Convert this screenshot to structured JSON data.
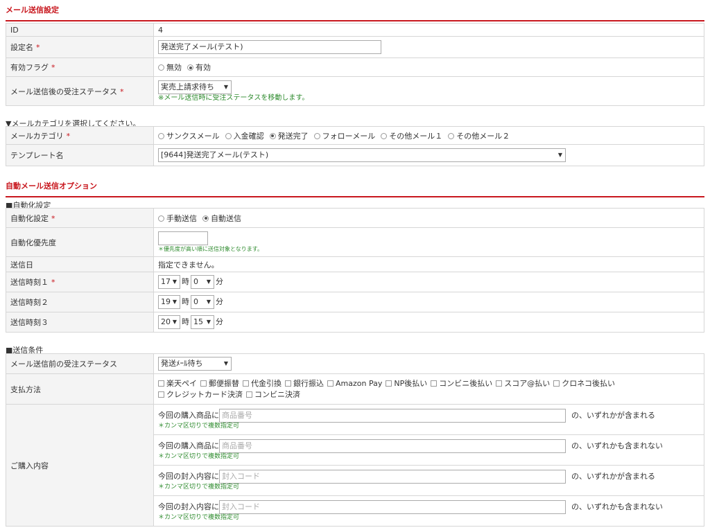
{
  "mail_section": {
    "title": "メール送信設定",
    "id_label": "ID",
    "id_value": "4",
    "name_label": "設定名",
    "name_value": "発送完了メール(テスト)",
    "flag_label": "有効フラグ",
    "flag_options": [
      "無効",
      "有効"
    ],
    "flag_selected": "有効",
    "after_status_label": "メール送信後の受注ステータス",
    "after_status_value": "実売上請求待ち",
    "after_status_note": "※メール送信時に受注ステータスを移動します。",
    "required_mark": "*"
  },
  "category_section": {
    "title": "▼メールカテゴリを選択してください。",
    "category_label": "メールカテゴリ",
    "categories": [
      "サンクスメール",
      "入金確認",
      "発送完了",
      "フォローメール",
      "その他メール１",
      "その他メール２"
    ],
    "category_selected": "発送完了",
    "template_label": "テンプレート名",
    "template_value": "[9644]発送完了メール(テスト)"
  },
  "auto_section": {
    "title": "自動メール送信オプション",
    "sub_title": "■自動化設定",
    "auto_label": "自動化設定",
    "auto_options": [
      "手動送信",
      "自動送信"
    ],
    "auto_selected": "自動送信",
    "priority_label": "自動化優先度",
    "priority_value": "",
    "priority_note": "＊優先度が高い順に送信対象となります。",
    "send_date_label": "送信日",
    "send_date_value": "指定できません。",
    "time_unit_hour": "時",
    "time_unit_min": "分",
    "times": [
      {
        "label": "送信時刻１",
        "hour": "17",
        "min": "0",
        "required": true
      },
      {
        "label": "送信時刻２",
        "hour": "19",
        "min": "0",
        "required": false
      },
      {
        "label": "送信時刻３",
        "hour": "20",
        "min": "15",
        "required": false
      }
    ]
  },
  "condition_section": {
    "sub_title": "■送信条件",
    "before_status_label": "メール送信前の受注ステータス",
    "before_status_value": "発送ﾒｰﾙ待ち",
    "payment_label": "支払方法",
    "payment_methods": [
      "楽天ペイ",
      "郵便振替",
      "代金引換",
      "銀行振込",
      "Amazon Pay",
      "NP後払い",
      "コンビニ後払い",
      "スコア@払い",
      "クロネコ後払い",
      "クレジットカード決済",
      "コンビニ決済"
    ],
    "purchase_label": "ご購入内容",
    "purchase_rows": [
      {
        "prefix": "今回の購入商品に",
        "placeholder": "商品番号",
        "suffix": "の、いずれかが含まれる",
        "note": "＊カンマ区切りで複数指定可"
      },
      {
        "prefix": "今回の購入商品に",
        "placeholder": "商品番号",
        "suffix": "の、いずれかも含まれない",
        "note": "＊カンマ区切りで複数指定可"
      },
      {
        "prefix": "今回の封入内容に",
        "placeholder": "封入コード",
        "suffix": "の、いずれかが含まれる",
        "note": "＊カンマ区切りで複数指定可"
      },
      {
        "prefix": "今回の封入内容に",
        "placeholder": "封入コード",
        "suffix": "の、いずれかも含まれない",
        "note": "＊カンマ区切りで複数指定可"
      }
    ]
  },
  "icons": {
    "dropdown": "dropdown-arrow-icon"
  },
  "colors": {
    "accent": "#c8161d",
    "note": "#2e8b2e",
    "label_bg": "#f4f4f4",
    "border": "#d6d6d6"
  }
}
